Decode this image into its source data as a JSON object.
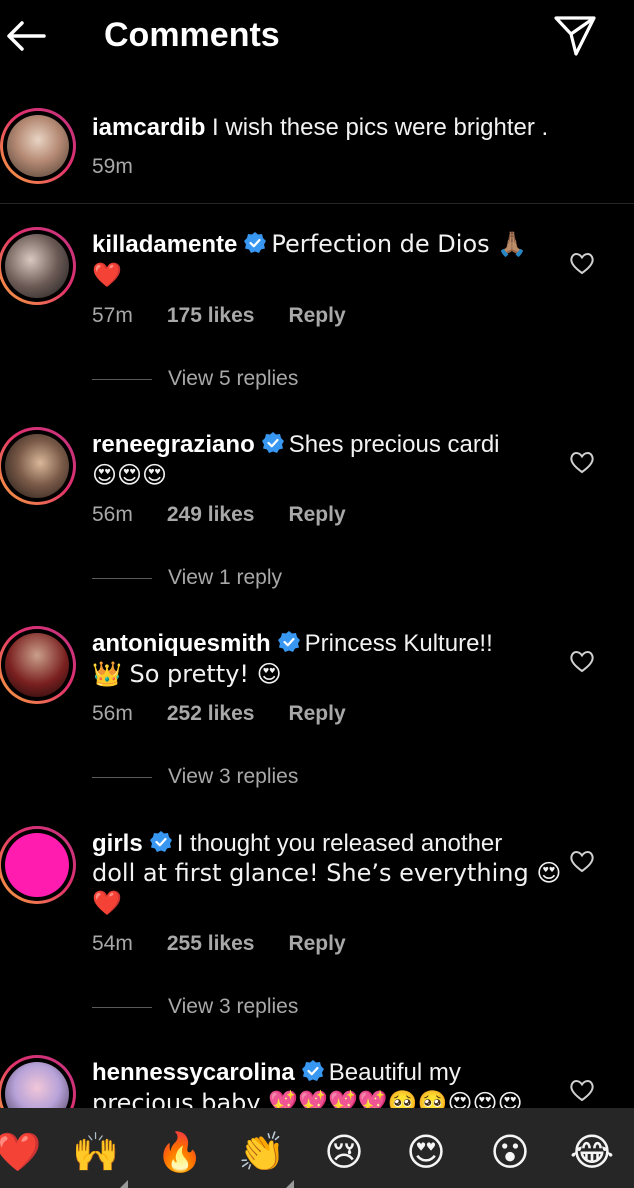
{
  "header": {
    "title": "Comments"
  },
  "caption": {
    "username": "iamcardib",
    "text": " I wish these pics were brighter .",
    "time": "59m"
  },
  "comments": [
    {
      "username": "killadamente",
      "text1": "Perfection de Dios 🙏🏽",
      "text2": "❤️",
      "time": "57m",
      "likes": "175 likes",
      "reply": "Reply",
      "view": "View 5 replies"
    },
    {
      "username": "reneegraziano",
      "text1": "Shes precious cardi",
      "text2": "😍😍😍",
      "time": "56m",
      "likes": "249 likes",
      "reply": "Reply",
      "view": "View 1 reply"
    },
    {
      "username": "antoniquesmith",
      "text1": "Princess Kulture!!",
      "text2": "👑 So pretty! 😍",
      "time": "56m",
      "likes": "252 likes",
      "reply": "Reply",
      "view": "View 3 replies"
    },
    {
      "username": "girls",
      "text1": "I thought you released another",
      "text2": "doll at first glance! She’s everything 😍",
      "text3": "❤️",
      "time": "54m",
      "likes": "255 likes",
      "reply": "Reply",
      "view": "View 3 replies"
    },
    {
      "username": "hennessycarolina",
      "text1": "Beautiful my",
      "text2": "precious baby 💖💖💖💖🥺🥺😍😍😍"
    }
  ],
  "reactions": [
    "❤️",
    "🙌",
    "🔥",
    "👏",
    "😢",
    "😍",
    "😮",
    "😂"
  ],
  "colors": {
    "verified": "#3897f0",
    "accent_ring_start": "#f9a83a",
    "accent_ring_end": "#c13584",
    "girls_avatar": "#ff1cae"
  }
}
